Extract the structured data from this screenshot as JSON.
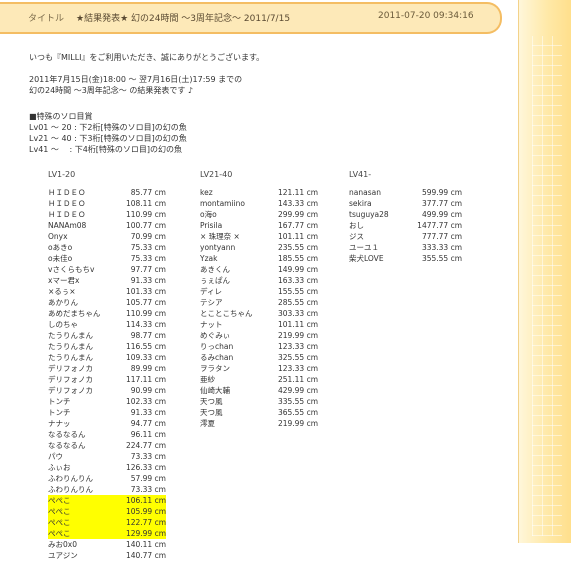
{
  "header": {
    "label": "タイトル",
    "title": "★結果発表★ 幻の24時間 ～3周年記念～ 2011/7/15",
    "datetime": "2011-07-20 09:34:16"
  },
  "body_lines": [
    "いつも『MILLI』をご利用いただき、誠にありがとうございます。",
    "",
    "2011年7月15日(金)18:00 ～ 翌7月16日(土)17:59 までの",
    "幻の24時間 ～3周年記念～ の結果発表です ♪",
    "",
    "■特殊のソロ目賞",
    "Lv01 ～ 20 : 下2桁[特殊のソロ目]の幻の魚",
    "Lv21 ～ 40 : 下3桁[特殊のソロ目]の幻の魚",
    "Lv41 ～　 : 下4桁[特殊のソロ目]の幻の魚"
  ],
  "columns": [
    {
      "heading": "LV1-20",
      "rows": [
        {
          "name": "ＨＩＤＥＯ",
          "value": "85.77 cm"
        },
        {
          "name": "ＨＩＤＥＯ",
          "value": "108.11 cm"
        },
        {
          "name": "ＨＩＤＥＯ",
          "value": "110.99 cm"
        },
        {
          "name": "NANAm08",
          "value": "100.77 cm"
        },
        {
          "name": "Onyx",
          "value": "70.99 cm"
        },
        {
          "name": "oあきo",
          "value": "75.33 cm"
        },
        {
          "name": "o未佳o",
          "value": "75.33 cm"
        },
        {
          "name": "vさくらもちv",
          "value": "97.77 cm"
        },
        {
          "name": "xマー君x",
          "value": "91.33 cm"
        },
        {
          "name": "×るぅ×",
          "value": "101.33 cm"
        },
        {
          "name": "あかりん",
          "value": "105.77 cm"
        },
        {
          "name": "あめだまちゃん",
          "value": "110.99 cm"
        },
        {
          "name": "しのちゃ",
          "value": "114.33 cm"
        },
        {
          "name": "たうりんまん",
          "value": "98.77 cm"
        },
        {
          "name": "たうりんまん",
          "value": "116.55 cm"
        },
        {
          "name": "たうりんまん",
          "value": "109.33 cm"
        },
        {
          "name": "デリフォノカ",
          "value": "89.99 cm"
        },
        {
          "name": "デリフォノカ",
          "value": "117.11 cm"
        },
        {
          "name": "デリフォノカ",
          "value": "90.99 cm"
        },
        {
          "name": "トンチ",
          "value": "102.33 cm"
        },
        {
          "name": "トンチ",
          "value": "91.33 cm"
        },
        {
          "name": "ナナッ",
          "value": "94.77 cm"
        },
        {
          "name": "なるなるん",
          "value": "96.11 cm"
        },
        {
          "name": "なるなるん",
          "value": "224.77 cm"
        },
        {
          "name": "パウ",
          "value": "73.33 cm"
        },
        {
          "name": "ふぃお",
          "value": "126.33 cm"
        },
        {
          "name": "ふわりんりん",
          "value": "57.99 cm"
        },
        {
          "name": "ふわりんりん",
          "value": "73.33 cm"
        },
        {
          "name": "ぺぺこ",
          "value": "106.11 cm",
          "highlight": true
        },
        {
          "name": "ぺぺこ",
          "value": "105.99 cm",
          "highlight": true
        },
        {
          "name": "ぺぺこ",
          "value": "122.77 cm",
          "highlight": true
        },
        {
          "name": "ぺぺこ",
          "value": "129.99 cm",
          "highlight": true
        },
        {
          "name": "みお0x0",
          "value": "140.11 cm"
        },
        {
          "name": "ユアジン",
          "value": "140.77 cm"
        }
      ]
    },
    {
      "heading": "LV21-40",
      "rows": [
        {
          "name": "kez",
          "value": "121.11 cm"
        },
        {
          "name": "montamiino",
          "value": "143.33 cm"
        },
        {
          "name": "o海o",
          "value": "299.99 cm"
        },
        {
          "name": "Prisila",
          "value": "167.77 cm"
        },
        {
          "name": "× 珠理奈 ×",
          "value": "101.11 cm"
        },
        {
          "name": "yontyann",
          "value": "235.55 cm"
        },
        {
          "name": "Yzak",
          "value": "185.55 cm"
        },
        {
          "name": "あきくん",
          "value": "149.99 cm"
        },
        {
          "name": "ぅぇぱん",
          "value": "163.33 cm"
        },
        {
          "name": "ディレ",
          "value": "155.55 cm"
        },
        {
          "name": "テシア",
          "value": "285.55 cm"
        },
        {
          "name": "とことこちゃん",
          "value": "303.33 cm"
        },
        {
          "name": "ナット",
          "value": "101.11 cm"
        },
        {
          "name": "めぐみぃ",
          "value": "219.99 cm"
        },
        {
          "name": "りっchan",
          "value": "123.33 cm"
        },
        {
          "name": "るみchan",
          "value": "325.55 cm"
        },
        {
          "name": "ヲラタン",
          "value": "123.33 cm"
        },
        {
          "name": "亜紗",
          "value": "251.11 cm"
        },
        {
          "name": "仙崎大輔",
          "value": "429.99 cm"
        },
        {
          "name": "天つ風",
          "value": "335.55 cm"
        },
        {
          "name": "天つ風",
          "value": "365.55 cm"
        },
        {
          "name": "澪夏",
          "value": "219.99 cm"
        }
      ]
    },
    {
      "heading": "LV41-",
      "rows": [
        {
          "name": "nanasan",
          "value": "599.99 cm"
        },
        {
          "name": "sekira",
          "value": "377.77 cm"
        },
        {
          "name": "tsuguya28",
          "value": "499.99 cm"
        },
        {
          "name": "おし",
          "value": "1477.77 cm"
        },
        {
          "name": "ジス",
          "value": "777.77 cm"
        },
        {
          "name": "ユーユ１",
          "value": "333.33 cm"
        },
        {
          "name": "柴犬LOVE",
          "value": "355.55 cm"
        }
      ]
    }
  ]
}
